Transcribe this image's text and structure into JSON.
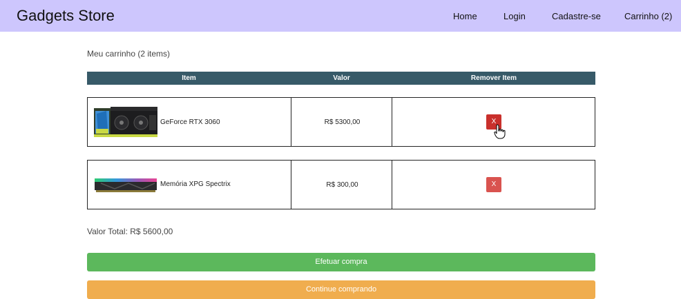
{
  "header": {
    "brand": "Gadgets Store",
    "nav": [
      "Home",
      "Login",
      "Cadastre-se",
      "Carrinho (2)"
    ],
    "background": "#cdc6fd"
  },
  "cart": {
    "title": "Meu carrinho (2 items)",
    "columns": [
      "Item",
      "Valor",
      "Remover Item"
    ],
    "header_color": "#375a68",
    "items": [
      {
        "name": "GeForce RTX 3060",
        "price": "R$ 5300,00",
        "remove_label": "X",
        "image_icon": "graphics-card-image"
      },
      {
        "name": "Memória XPG Spectrix",
        "price": "R$ 300,00",
        "remove_label": "X",
        "image_icon": "ram-module-image"
      }
    ],
    "total": "Valor Total: R$ 5600,00"
  },
  "actions": {
    "checkout": "Efetuar compra",
    "continue": "Continue comprando",
    "checkout_color": "#5cb85c",
    "continue_color": "#f0ad4e",
    "remove_color": "#d9534f"
  }
}
